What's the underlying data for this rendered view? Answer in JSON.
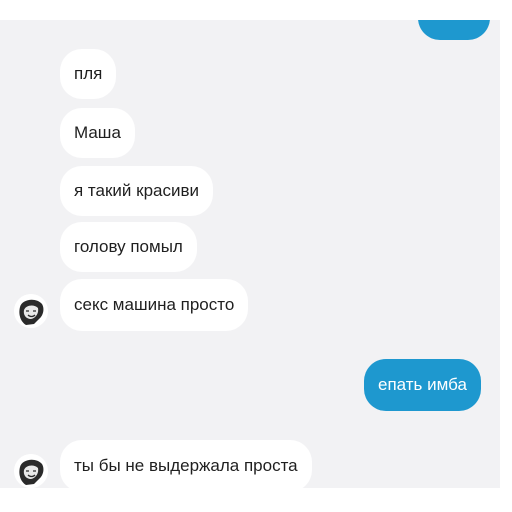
{
  "conversation": {
    "messages": [
      {
        "from": "other",
        "text": "пля"
      },
      {
        "from": "other",
        "text": "Маша"
      },
      {
        "from": "other",
        "text": "я такий красиви"
      },
      {
        "from": "other",
        "text": "голову помыл"
      },
      {
        "from": "other",
        "text": "секс машина просто"
      },
      {
        "from": "self",
        "text": "епать имба"
      },
      {
        "from": "other",
        "text": "ты бы не выдержала проста"
      }
    ],
    "colors": {
      "background": "#f2f2f4",
      "incoming_bubble": "#ffffff",
      "outgoing_bubble": "#1e98cf",
      "incoming_text": "#1f1f1f",
      "outgoing_text": "#ffffff"
    }
  }
}
